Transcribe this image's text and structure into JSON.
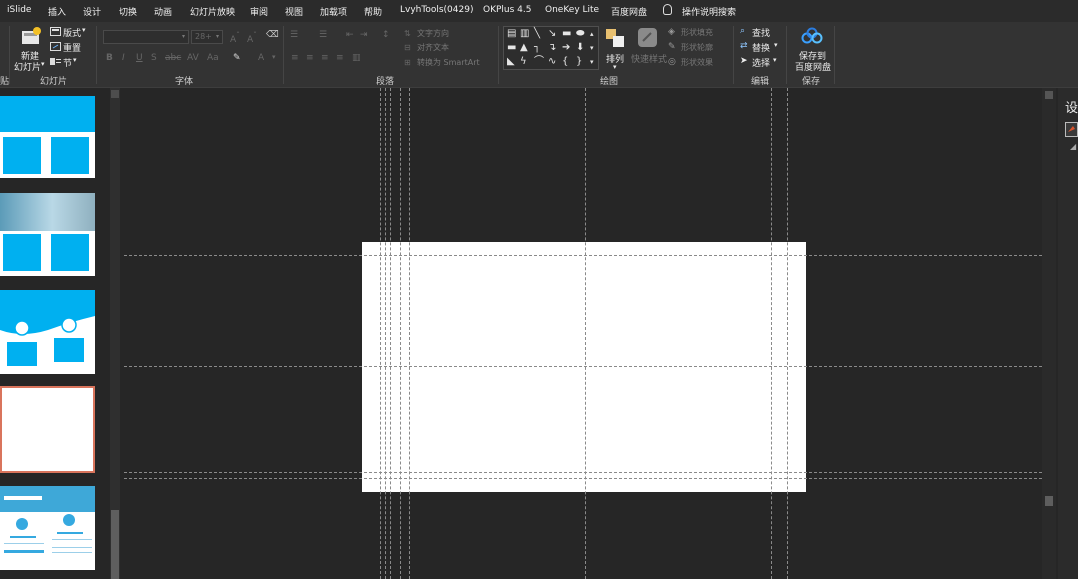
{
  "menu": {
    "tabs": [
      "iSlide",
      "插入",
      "设计",
      "切换",
      "动画",
      "幻灯片放映",
      "审阅",
      "视图",
      "加载项",
      "帮助",
      "LvyhTools(0429)",
      "OKPlus 4.5",
      "OneKey Lite",
      "百度网盘"
    ],
    "search_label": "操作说明搜索"
  },
  "ribbon": {
    "slides": {
      "new_slide_line1": "新建",
      "new_slide_line2": "幻灯片",
      "layout": "版式",
      "reset": "重置",
      "section": "节",
      "group": "幻灯片",
      "left_group_fragment": "贴"
    },
    "font": {
      "font_size": "28+",
      "group": "字体"
    },
    "paragraph": {
      "text_direction": "文字方向",
      "align_text": "对齐文本",
      "smartart": "转换为 SmartArt",
      "group": "段落"
    },
    "drawing": {
      "arrange": "排列",
      "quick_styles_line1": "快速样式",
      "shape_fill": "形状填充",
      "shape_outline": "形状轮廓",
      "shape_effects": "形状效果",
      "group": "绘图"
    },
    "editing": {
      "find": "查找",
      "replace": "替换",
      "select": "选择",
      "group": "编辑"
    },
    "save": {
      "line1": "保存到",
      "line2": "百度网盘",
      "group": "保存"
    }
  },
  "right_pane": {
    "title_fragment": "设"
  }
}
